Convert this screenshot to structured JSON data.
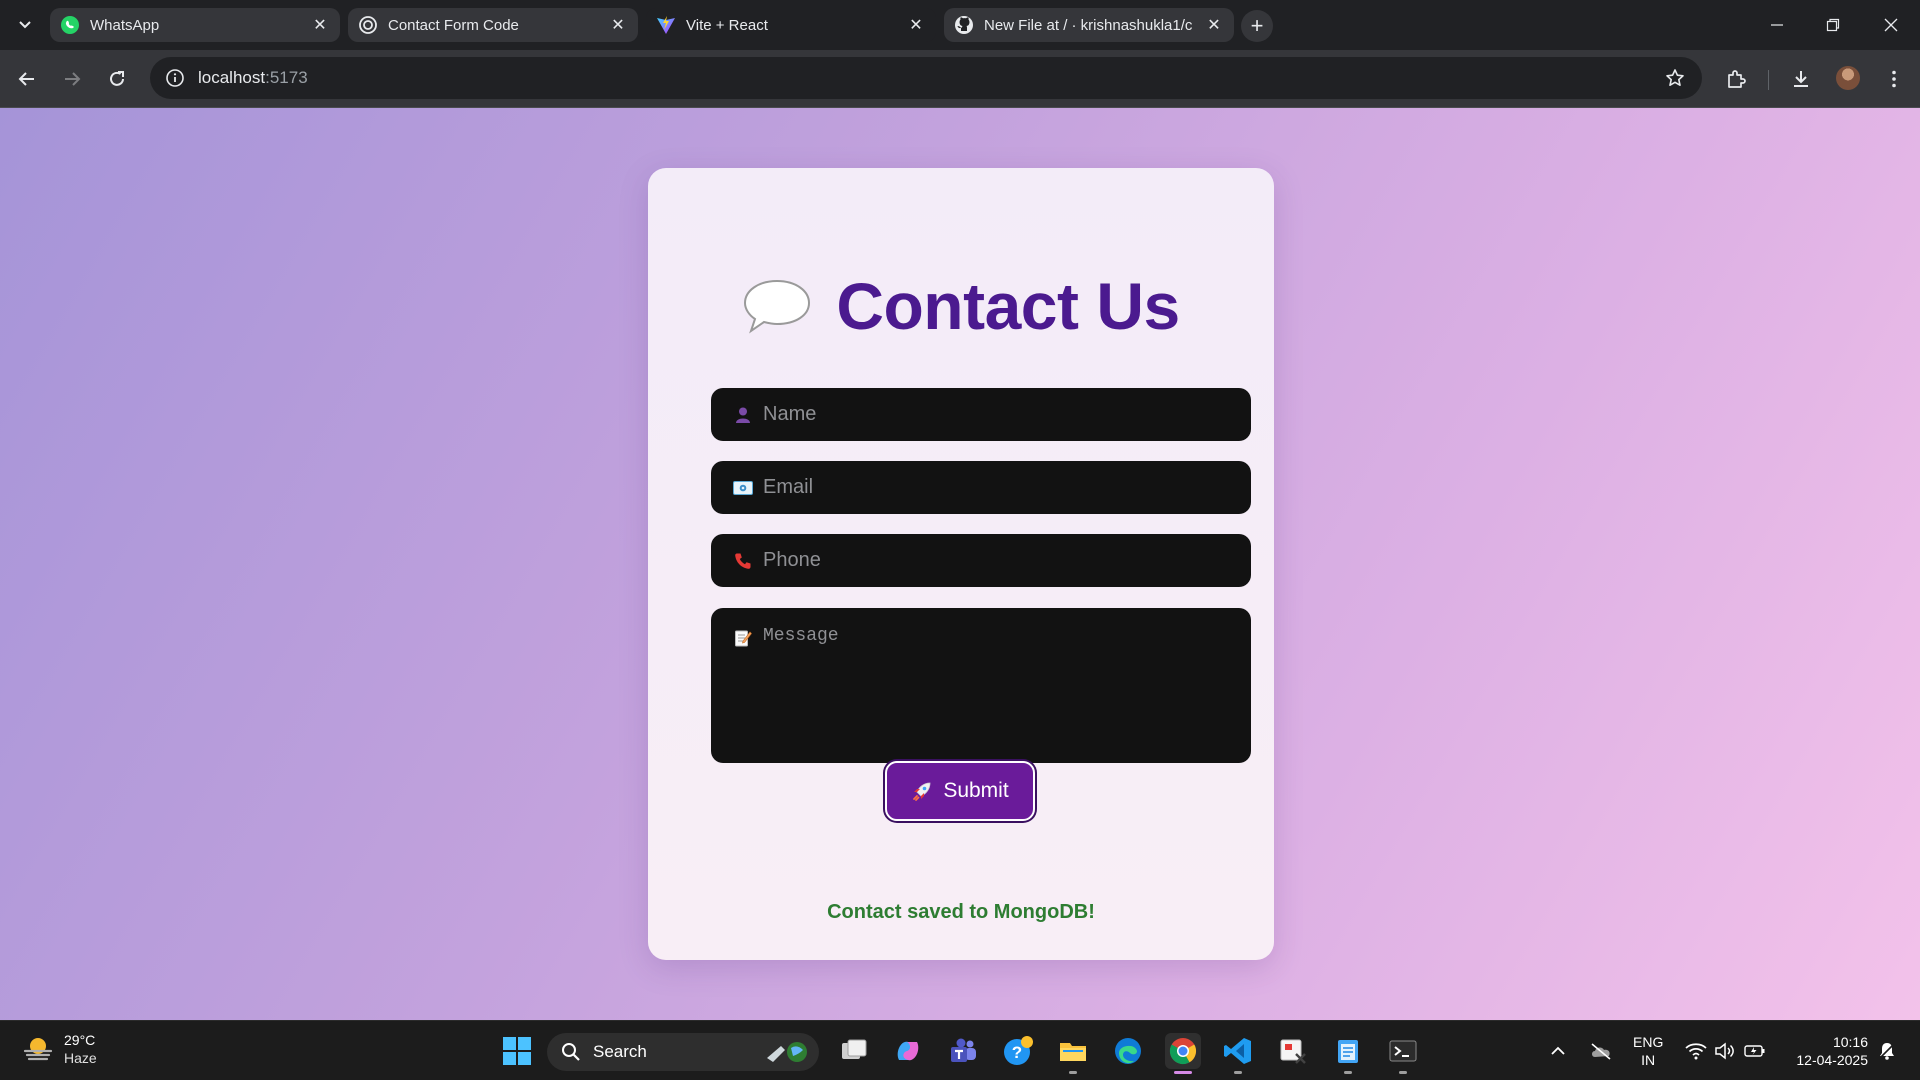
{
  "browser": {
    "tabs": [
      {
        "title": "WhatsApp",
        "icon": "whatsapp-icon"
      },
      {
        "title": "Contact Form Code",
        "icon": "chatgpt-icon"
      },
      {
        "title": "Vite + React",
        "icon": "vite-icon"
      },
      {
        "title": "New File at / · krishnashukla1/c",
        "icon": "github-icon"
      }
    ],
    "address": {
      "host": "localhost",
      "port": ":5173"
    }
  },
  "page": {
    "title": "Contact Us",
    "title_icon": "speech-bubble-icon",
    "fields": {
      "name_placeholder": "Name",
      "email_placeholder": "Email",
      "phone_placeholder": "Phone",
      "message_placeholder": "Message"
    },
    "submit_label": "Submit",
    "status_message": "Contact saved to MongoDB!",
    "colors": {
      "title": "#4b1a8f",
      "button": "#6a1b9a",
      "status": "#2e7d32",
      "field_bg": "#121212"
    }
  },
  "taskbar": {
    "weather": {
      "temp": "29°C",
      "desc": "Haze"
    },
    "search_label": "Search",
    "language": {
      "line1": "ENG",
      "line2": "IN"
    },
    "clock": {
      "time": "10:16",
      "date": "12-04-2025"
    }
  }
}
